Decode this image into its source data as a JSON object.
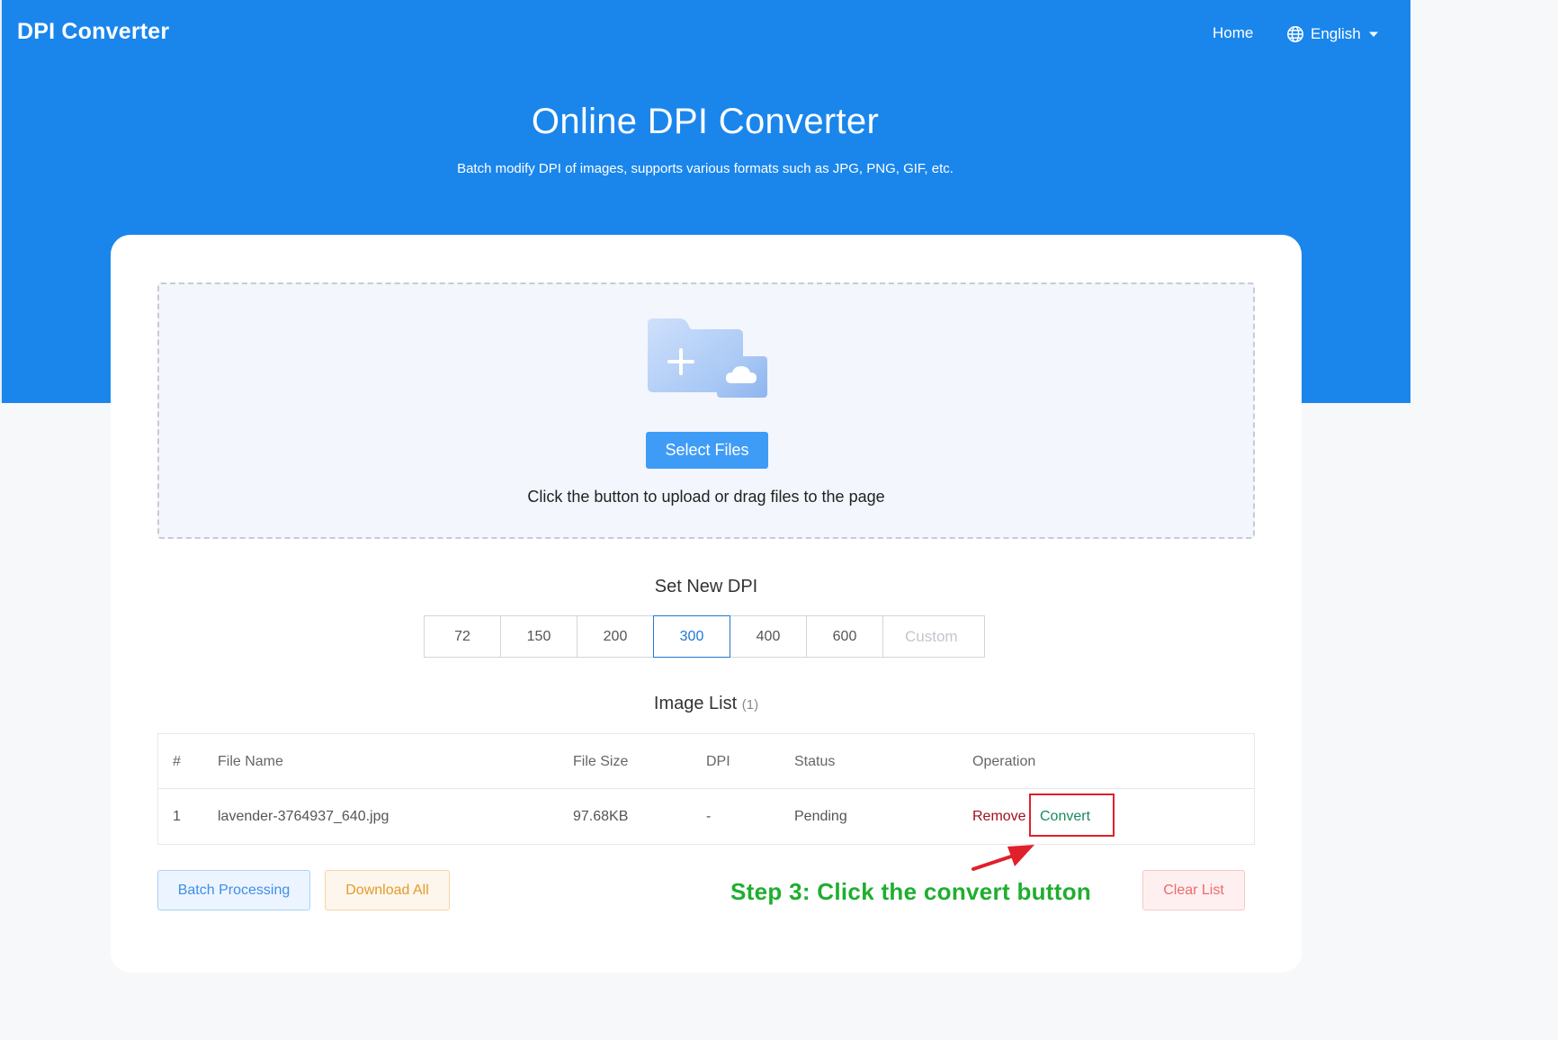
{
  "header": {
    "brand": "DPI Converter",
    "nav_home": "Home",
    "language": "English",
    "language_icon": "globe-icon",
    "language_caret_icon": "caret-down-icon"
  },
  "hero": {
    "title": "Online DPI Converter",
    "subtitle": "Batch modify DPI of images, supports various formats such as JPG, PNG, GIF, etc."
  },
  "upload": {
    "icon": "folder-upload-icon",
    "button_label": "Select Files",
    "hint": "Click the button to upload or drag files to the page"
  },
  "dpi": {
    "title": "Set New DPI",
    "options": [
      "72",
      "150",
      "200",
      "300",
      "400",
      "600"
    ],
    "selected": "300",
    "custom_placeholder": "Custom"
  },
  "image_list": {
    "title": "Image List",
    "count": "(1)",
    "columns": {
      "num": "#",
      "file_name": "File Name",
      "file_size": "File Size",
      "dpi": "DPI",
      "status": "Status",
      "operation": "Operation"
    },
    "rows": [
      {
        "num": "1",
        "file_name": "lavender-3764937_640.jpg",
        "file_size": "97.68KB",
        "dpi": "-",
        "status": "Pending",
        "remove_label": "Remove",
        "convert_label": "Convert"
      }
    ]
  },
  "actions": {
    "batch_label": "Batch Processing",
    "download_label": "Download All",
    "clear_label": "Clear List"
  },
  "annotation": {
    "text": "Step 3: Click the convert button"
  },
  "colors": {
    "primary": "#1a86ec",
    "select_button": "#3f9cf6",
    "annotation": "#1fae2f",
    "highlight_border": "#e0202a",
    "remove": "#a30f1f",
    "convert": "#1a8a5a"
  }
}
